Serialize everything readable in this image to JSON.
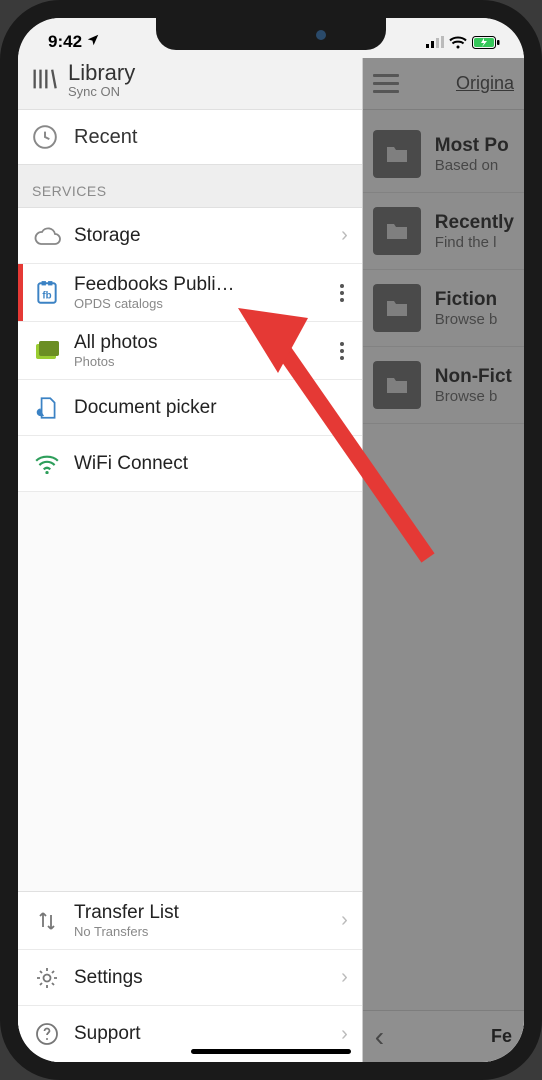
{
  "status": {
    "time": "9:42"
  },
  "header": {
    "title": "Library",
    "subtitle": "Sync ON"
  },
  "recent": {
    "label": "Recent"
  },
  "section": {
    "services": "SERVICES"
  },
  "services": {
    "storage": {
      "title": "Storage"
    },
    "feedbooks": {
      "title": "Feedbooks Publi…",
      "sub": "OPDS catalogs"
    },
    "photos": {
      "title": "All photos",
      "sub": "Photos"
    },
    "docpicker": {
      "title": "Document picker"
    },
    "wifi": {
      "title": "WiFi Connect"
    }
  },
  "bottom": {
    "transfer": {
      "title": "Transfer List",
      "sub": "No Transfers"
    },
    "settings": {
      "title": "Settings"
    },
    "support": {
      "title": "Support"
    }
  },
  "right": {
    "header_link": "Origina",
    "items": [
      {
        "title": "Most Po",
        "sub": "Based on"
      },
      {
        "title": "Recently",
        "sub": "Find the l"
      },
      {
        "title": "Fiction",
        "sub": "Browse b"
      },
      {
        "title": "Non-Fict",
        "sub": "Browse b"
      }
    ],
    "footer_back": "‹",
    "footer_text": "Fe"
  }
}
